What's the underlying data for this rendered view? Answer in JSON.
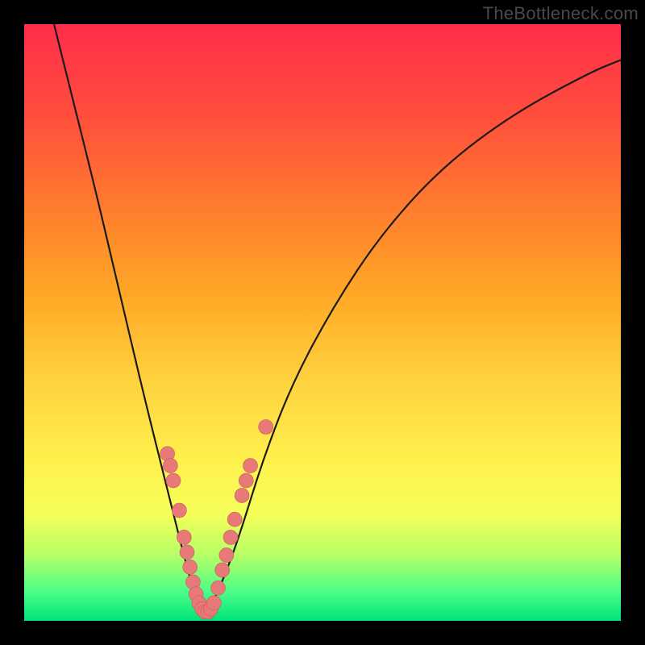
{
  "watermark": "TheBottleneck.com",
  "colors": {
    "curve_stroke": "#1b1b1b",
    "marker_fill": "#e77a78",
    "marker_stroke": "#c95a58",
    "frame": "#000000"
  },
  "chart_data": {
    "type": "line",
    "title": "",
    "xlabel": "",
    "ylabel": "",
    "xlim": [
      0,
      100
    ],
    "ylim": [
      0,
      100
    ],
    "note": "V-shaped bottleneck curve with minimum near x≈30. No axis ticks or labels are rendered. Curve y-values estimated from pixel positions.",
    "series": [
      {
        "name": "bottleneck-curve",
        "x": [
          5,
          8,
          12,
          16,
          20,
          24,
          27,
          29,
          30,
          31,
          33,
          36,
          40,
          45,
          52,
          60,
          70,
          82,
          95,
          100
        ],
        "y": [
          100,
          88,
          72,
          55,
          38,
          22,
          10,
          3,
          1,
          2,
          6,
          14,
          27,
          40,
          53,
          65,
          76,
          85,
          92,
          94
        ]
      }
    ],
    "markers": [
      {
        "x": 24.0,
        "y": 28.0
      },
      {
        "x": 24.5,
        "y": 26.0
      },
      {
        "x": 25.0,
        "y": 23.5
      },
      {
        "x": 26.0,
        "y": 18.5
      },
      {
        "x": 26.8,
        "y": 14.0
      },
      {
        "x": 27.3,
        "y": 11.5
      },
      {
        "x": 27.8,
        "y": 9.0
      },
      {
        "x": 28.3,
        "y": 6.5
      },
      {
        "x": 28.8,
        "y": 4.5
      },
      {
        "x": 29.3,
        "y": 3.0
      },
      {
        "x": 29.8,
        "y": 2.0
      },
      {
        "x": 30.3,
        "y": 1.5
      },
      {
        "x": 30.8,
        "y": 1.5
      },
      {
        "x": 31.3,
        "y": 2.0
      },
      {
        "x": 31.8,
        "y": 3.0
      },
      {
        "x": 32.5,
        "y": 5.5
      },
      {
        "x": 33.2,
        "y": 8.5
      },
      {
        "x": 33.9,
        "y": 11.0
      },
      {
        "x": 34.6,
        "y": 14.0
      },
      {
        "x": 35.3,
        "y": 17.0
      },
      {
        "x": 36.5,
        "y": 21.0
      },
      {
        "x": 37.2,
        "y": 23.5
      },
      {
        "x": 37.9,
        "y": 26.0
      },
      {
        "x": 40.5,
        "y": 32.5
      }
    ]
  }
}
